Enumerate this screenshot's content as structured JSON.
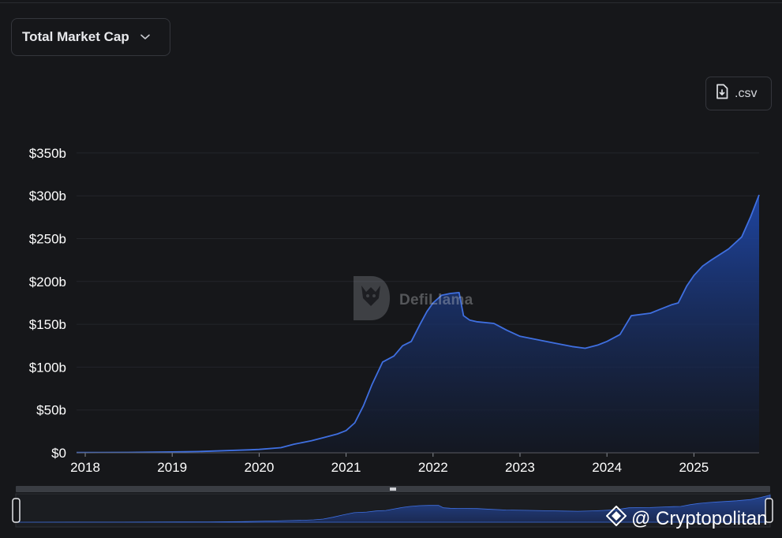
{
  "header": {
    "dropdown_label": "Total Market Cap",
    "dropdown_icon": "chevron-down-icon",
    "csv_label": ".csv",
    "csv_icon": "download-file-icon"
  },
  "watermark": {
    "text": "DefiLlama",
    "icon": "llama-logo-icon"
  },
  "brand": {
    "text": "@ Cryptopolitan",
    "icon": "cryptopolitan-diamond-icon"
  },
  "colors": {
    "background": "#16171a",
    "line": "#3f6fe0",
    "area_top": "#1f47a8",
    "area_bottom": "#121826",
    "grid": "#23252a",
    "border": "#34363c"
  },
  "chart_data": {
    "type": "area",
    "title": "Total Market Cap",
    "xlabel": "",
    "ylabel": "",
    "x_ticks": [
      "2018",
      "2019",
      "2020",
      "2021",
      "2022",
      "2023",
      "2024",
      "2025"
    ],
    "y_ticks": [
      "$0",
      "$50b",
      "$100b",
      "$150b",
      "$200b",
      "$250b",
      "$300b",
      "$350b"
    ],
    "y_tick_values": [
      0,
      50,
      100,
      150,
      200,
      250,
      300,
      350
    ],
    "ylim": [
      0,
      350
    ],
    "xlim": [
      2017.9,
      2025.75
    ],
    "unit": "billions USD",
    "grid": true,
    "legend": "none",
    "series": [
      {
        "x": [
          2017.9,
          2018.5,
          2019.0,
          2019.3,
          2019.6,
          2019.9,
          2020.0,
          2020.25,
          2020.4,
          2020.6,
          2020.75,
          2020.9,
          2021.0,
          2021.1,
          2021.2,
          2021.3,
          2021.42,
          2021.55,
          2021.65,
          2021.75,
          2021.85,
          2021.93,
          2022.0,
          2022.1,
          2022.2,
          2022.3,
          2022.35,
          2022.42,
          2022.5,
          2022.7,
          2022.85,
          2023.0,
          2023.2,
          2023.4,
          2023.6,
          2023.75,
          2023.9,
          2024.0,
          2024.15,
          2024.28,
          2024.5,
          2024.6,
          2024.75,
          2024.82,
          2024.92,
          2025.0,
          2025.1,
          2025.2,
          2025.4,
          2025.55,
          2025.65,
          2025.75
        ],
        "values": [
          0.3,
          0.5,
          1,
          1.5,
          2.5,
          3.5,
          4,
          6,
          10,
          14,
          18,
          22,
          26,
          35,
          55,
          80,
          106,
          113,
          125,
          130,
          150,
          165,
          175,
          184,
          186,
          187,
          160,
          155,
          153,
          151,
          143,
          136,
          132,
          128,
          124,
          122,
          126,
          130,
          138,
          160,
          163,
          167,
          173,
          175,
          195,
          207,
          218,
          225,
          238,
          252,
          275,
          301
        ]
      }
    ]
  }
}
